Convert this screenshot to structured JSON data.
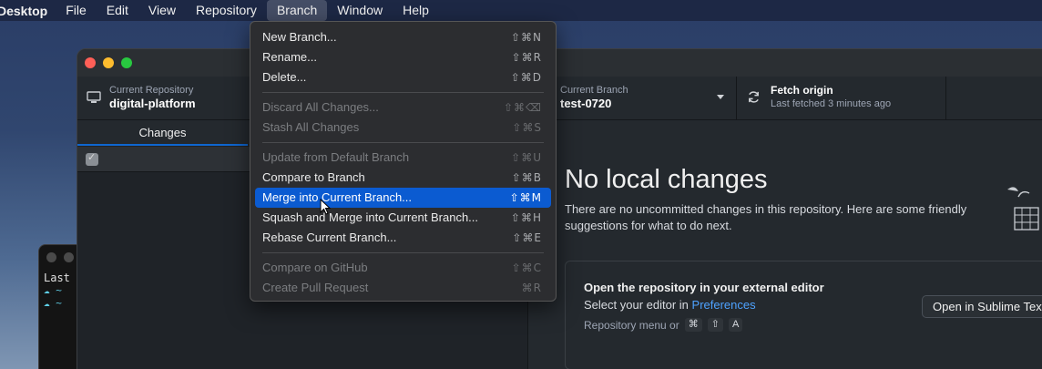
{
  "menubar": {
    "app_name": "Desktop",
    "items": [
      "File",
      "Edit",
      "View",
      "Repository",
      "Branch",
      "Window",
      "Help"
    ],
    "active": "Branch"
  },
  "terminal": {
    "line1": "Last",
    "prompt1": "☁ ~",
    "prompt2": "☁ ~"
  },
  "toolbar": {
    "repo_label": "Current Repository",
    "repo_value": "digital-platform",
    "branch_label": "Current Branch",
    "branch_value": "test-0720",
    "fetch_title": "Fetch origin",
    "fetch_sub": "Last fetched 3 minutes ago"
  },
  "sidebar": {
    "tab_changes": "Changes"
  },
  "main": {
    "title": "No local changes",
    "description": "There are no uncommitted changes in this repository. Here are some friendly suggestions for what to do next.",
    "card": {
      "title": "Open the repository in your external editor",
      "line_prefix": "Select your editor in",
      "link": "Preferences",
      "hint_prefix": "Repository menu or",
      "key1": "⌘",
      "key2": "⇧",
      "key3": "A",
      "button": "Open in Sublime Text"
    }
  },
  "branch_menu": {
    "new_branch": {
      "label": "New Branch...",
      "shortcut": "⇧⌘N"
    },
    "rename": {
      "label": "Rename...",
      "shortcut": "⇧⌘R"
    },
    "delete": {
      "label": "Delete...",
      "shortcut": "⇧⌘D"
    },
    "discard_all": {
      "label": "Discard All Changes...",
      "shortcut": "⇧⌘⌫"
    },
    "stash_all": {
      "label": "Stash All Changes",
      "shortcut": "⇧⌘S"
    },
    "update_default": {
      "label": "Update from Default Branch",
      "shortcut": "⇧⌘U"
    },
    "compare_branch": {
      "label": "Compare to Branch",
      "shortcut": "⇧⌘B"
    },
    "merge_current": {
      "label": "Merge into Current Branch...",
      "shortcut": "⇧⌘M"
    },
    "squash_merge": {
      "label": "Squash and Merge into Current Branch...",
      "shortcut": "⇧⌘H"
    },
    "rebase": {
      "label": "Rebase Current Branch...",
      "shortcut": "⇧⌘E"
    },
    "compare_github": {
      "label": "Compare on GitHub",
      "shortcut": "⇧⌘C"
    },
    "create_pr": {
      "label": "Create Pull Request",
      "shortcut": "⌘R"
    }
  },
  "colors": {
    "accent": "#0b5bd1",
    "link": "#4ea2ff",
    "window_bg": "#24292e"
  }
}
